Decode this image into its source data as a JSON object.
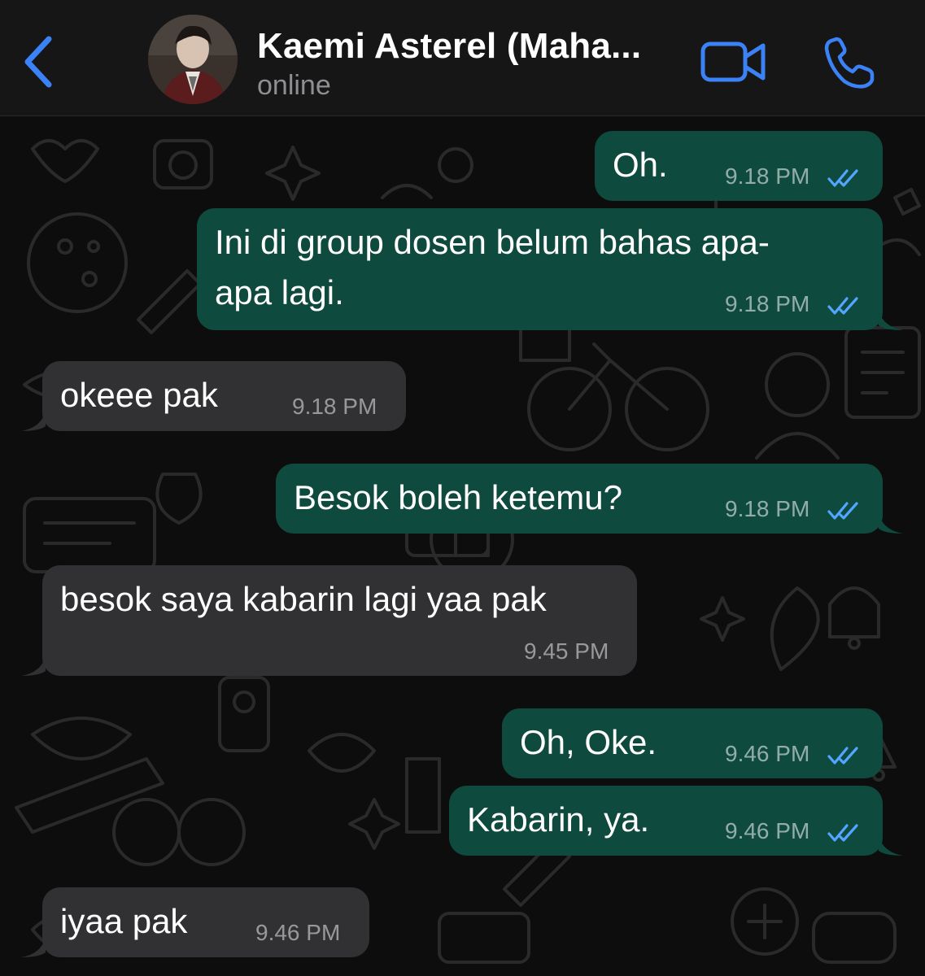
{
  "header": {
    "back_icon": "chevron-left-icon",
    "contact_name": "Kaemi Asterel (Maha...",
    "status": "online",
    "video_icon": "video-camera-icon",
    "call_icon": "phone-icon",
    "accent_color": "#3b82f6"
  },
  "colors": {
    "outgoing_bubble": "#0f4a3e",
    "incoming_bubble": "#313133",
    "read_ticks": "#53a6ff"
  },
  "messages": [
    {
      "direction": "outgoing",
      "text": "Oh.",
      "time": "9.18 PM",
      "read": true
    },
    {
      "direction": "outgoing",
      "line1": "Ini di group dosen belum bahas apa-",
      "line2": "apa lagi.",
      "time": "9.18 PM",
      "read": true
    },
    {
      "direction": "incoming",
      "text": "okeee pak",
      "time": "9.18 PM"
    },
    {
      "direction": "outgoing",
      "text": "Besok boleh ketemu?",
      "time": "9.18 PM",
      "read": true
    },
    {
      "direction": "incoming",
      "text": "besok saya kabarin lagi yaa pak",
      "time": "9.45 PM"
    },
    {
      "direction": "outgoing",
      "text": "Oh, Oke.",
      "time": "9.46 PM",
      "read": true
    },
    {
      "direction": "outgoing",
      "text": "Kabarin, ya.",
      "time": "9.46 PM",
      "read": true
    },
    {
      "direction": "incoming",
      "text": "iyaa pak",
      "time": "9.46 PM"
    }
  ]
}
